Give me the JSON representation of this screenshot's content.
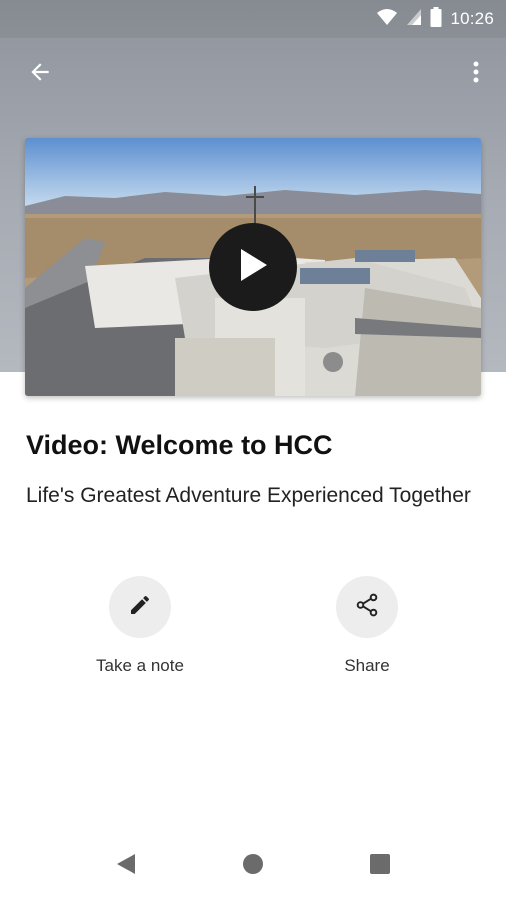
{
  "status_bar": {
    "time": "10:26"
  },
  "colors": {
    "header_gray": "#a0a5ad",
    "play_button": "#1b1b1b",
    "action_circle": "#ededed"
  },
  "header": {
    "back_icon": "arrow-left-icon",
    "menu_icon": "more-vert-icon"
  },
  "video": {
    "thumbnail_icon": "play-icon"
  },
  "content": {
    "title": "Video: Welcome to HCC",
    "subtitle": "Life's Greatest Adventure Experienced Together"
  },
  "actions": [
    {
      "label": "Take a note",
      "icon": "pencil-icon"
    },
    {
      "label": "Share",
      "icon": "share-icon"
    }
  ],
  "nav_bar": {
    "back": "nav-back-icon",
    "home": "nav-home-icon",
    "recents": "nav-recents-icon"
  }
}
